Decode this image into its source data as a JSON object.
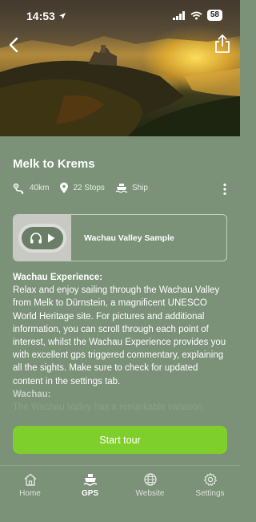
{
  "status": {
    "time": "14:53",
    "battery": "58"
  },
  "tour": {
    "title": "Melk to Krems",
    "distance": "40km",
    "stops": "22 Stops",
    "transport": "Ship"
  },
  "audio_sample": {
    "title": "Wachau Valley Sample"
  },
  "description": {
    "heading": "Wachau Experience:",
    "body": "Relax and enjoy sailing through the Wachau Valley from Melk to Dürnstein, a magnificent UNESCO World Heritage site. For pictures and additional information, you can scroll through each point of interest, whilst the Wachau Experience provides you with excellent gps triggered commentary, explaining all the sights. Make sure to check for updated content in the settings tab.",
    "sub_heading": "Wachau:",
    "faded_line": "The Wachau Valley has a remarkable variation"
  },
  "start_button": {
    "label": "Start tour"
  },
  "tabs": [
    {
      "label": "Home",
      "icon": "home-icon",
      "active": false
    },
    {
      "label": "GPS",
      "icon": "ship-icon",
      "active": true
    },
    {
      "label": "Website",
      "icon": "globe-icon",
      "active": false
    },
    {
      "label": "Settings",
      "icon": "gear-icon",
      "active": false
    }
  ],
  "colors": {
    "background": "#7b9178",
    "accent": "#7ecf2c"
  }
}
